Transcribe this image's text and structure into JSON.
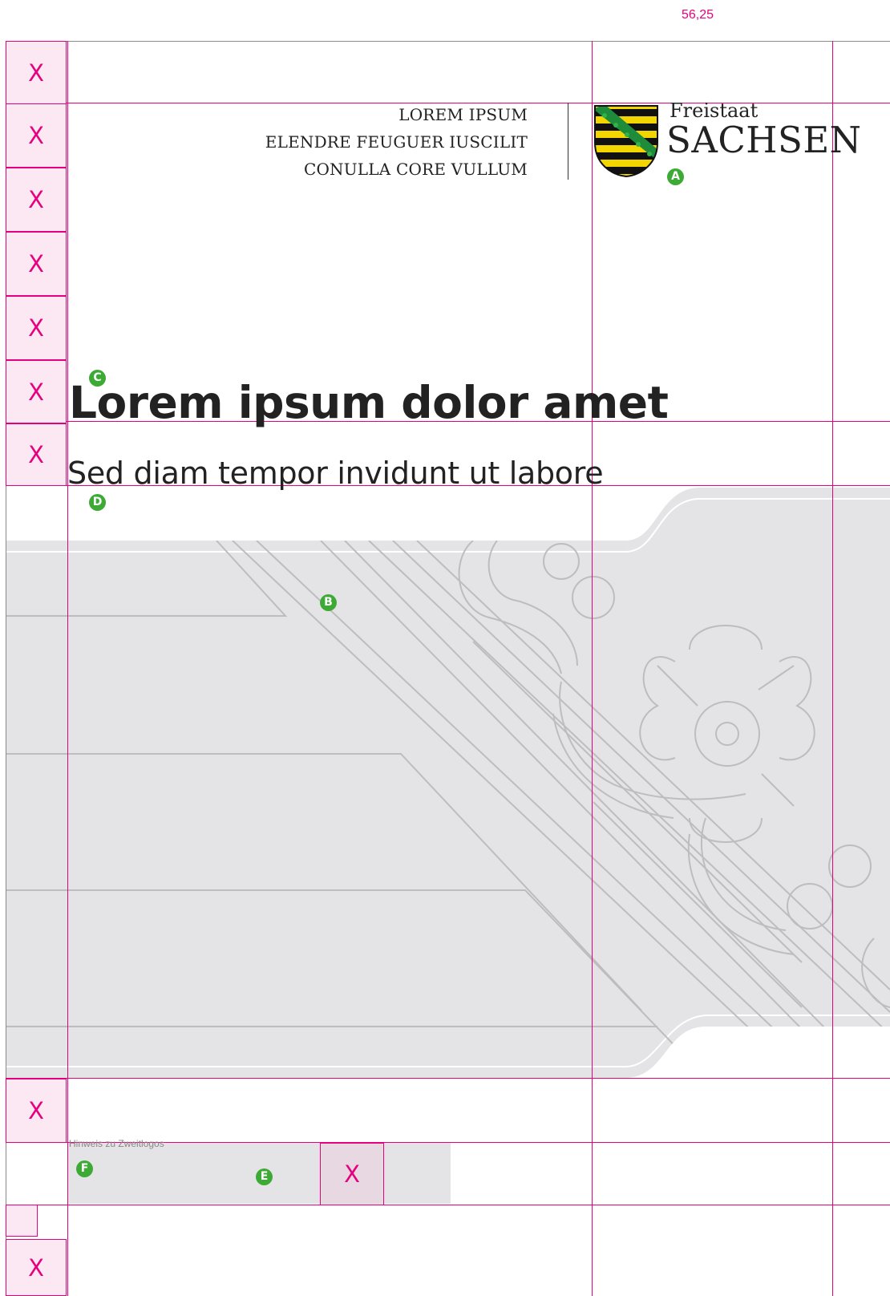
{
  "measure_label": "56,25",
  "margin_marker": "X",
  "header": {
    "address_lines": [
      "LOREM IPSUM",
      "ELENDRE FEUGUER IUSCILIT",
      "CONULLA CORE VULLUM"
    ],
    "logo": {
      "line1": "Freistaat",
      "line2": "SACHSEN"
    }
  },
  "title": "Lorem ipsum dolor amet",
  "subtitle": "Sed diam tempor invidunt ut labore",
  "footer": {
    "hint": "Hinweis zu Zweitlogos",
    "logo_placeholder": "X"
  },
  "markers": {
    "a": "A",
    "b": "B",
    "c": "C",
    "d": "D",
    "e": "E",
    "f": "F"
  },
  "colors": {
    "guide": "#e6007e",
    "guide_fill": "#fce8f2",
    "marker": "#3daa35",
    "band": "#e4e4e6",
    "band_lines": "#bdbdc0",
    "text": "#222222"
  }
}
